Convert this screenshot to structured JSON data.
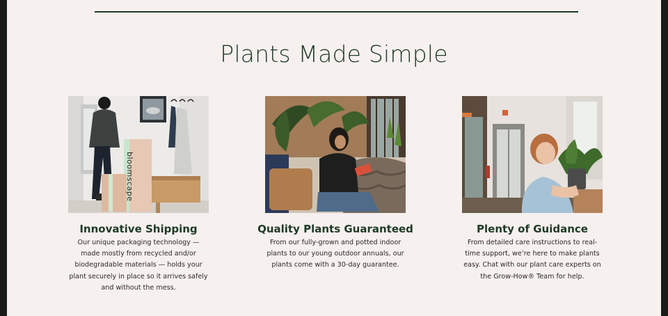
{
  "section": {
    "title": "Plants Made Simple"
  },
  "features": [
    {
      "heading": "Innovative Shipping",
      "body": "Our unique packaging technology — made mostly from recycled and/or biodegradable materials — holds your plant securely in place so it arrives safely and without the mess.",
      "box_print": "bloomscape"
    },
    {
      "heading": "Quality Plants Guaranteed",
      "body": "From our fully-grown and potted indoor plants to our young outdoor annuals, our plants come with a 30-day guarantee."
    },
    {
      "heading": "Plenty of Guidance",
      "body": "From detailed care instructions to real-time support, we’re here to make plants easy. Chat with our plant care experts on the Grow-How® Team for help."
    }
  ],
  "colors": {
    "background": "#f6f0ef",
    "accent": "#1f3a25"
  }
}
